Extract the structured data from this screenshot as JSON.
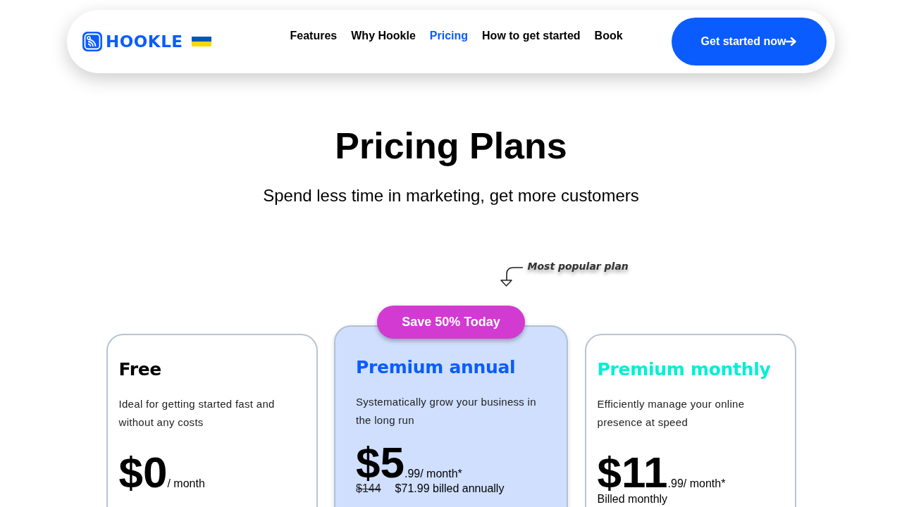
{
  "nav": {
    "logo": "HOOKLE",
    "links": [
      {
        "label": "Features",
        "selected": false
      },
      {
        "label": "Why Hookle",
        "selected": false
      },
      {
        "label": "Pricing",
        "selected": true
      },
      {
        "label": "How to get started",
        "selected": false
      },
      {
        "label": "Book",
        "selected": false
      }
    ],
    "cta": "Get started now"
  },
  "hero": {
    "title": "Pricing Plans",
    "subtitle": "Spend less time in marketing, get more customers"
  },
  "popular_note": "Most popular plan",
  "plans": [
    {
      "name": "Free",
      "color": "#000000",
      "featured": false,
      "description": "Ideal for getting started fast and without any costs",
      "price": "$0",
      "price_suffix": "/ month"
    },
    {
      "name": "Premium annual",
      "color": "#0a5cff",
      "featured": true,
      "badge": "Save 50% Today",
      "description": "Systematically grow your business in the long run",
      "price": "$5",
      "price_suffix": ".99/ month*",
      "old_price": "$144",
      "billing": "$71.99 billed annually"
    },
    {
      "name": "Premium monthly",
      "color": "#00f0d4",
      "featured": false,
      "description": "Efficiently manage your online presence at speed",
      "price": "$11",
      "price_suffix": ".99/ month*",
      "billing": "Billed monthly"
    }
  ]
}
